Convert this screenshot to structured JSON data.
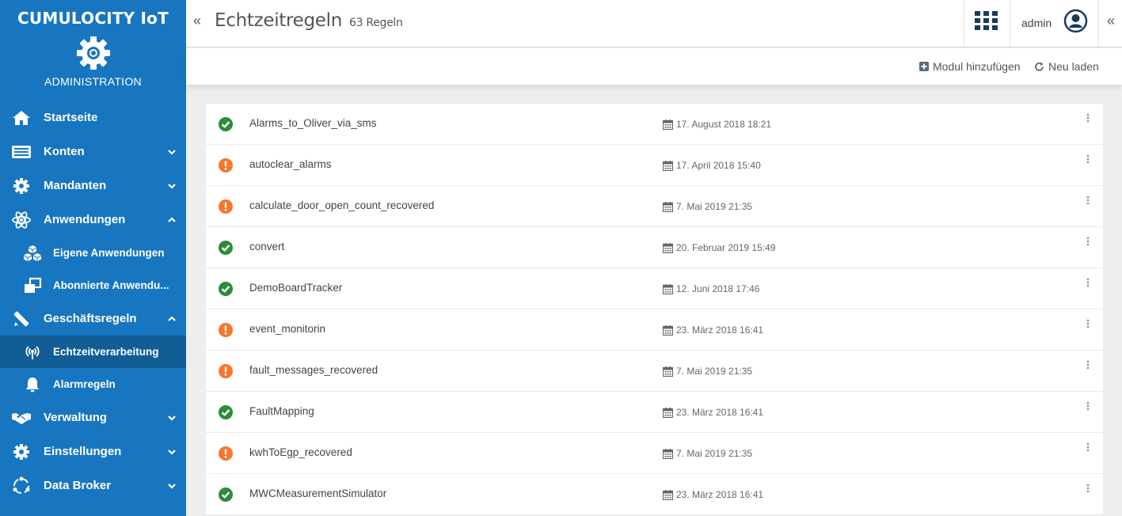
{
  "brand": {
    "title": "CUMULOCITY IoT",
    "subtitle": "ADMINISTRATION"
  },
  "sidebar": {
    "items": [
      {
        "label": "Startseite",
        "icon": "home-icon"
      },
      {
        "label": "Konten",
        "icon": "accounts-icon",
        "expanded": false
      },
      {
        "label": "Mandanten",
        "icon": "tenants-icon",
        "expanded": false
      },
      {
        "label": "Anwendungen",
        "icon": "atom-icon",
        "expanded": true
      },
      {
        "label": "Eigene Anwendungen",
        "icon": "cubes-icon"
      },
      {
        "label": "Abonnierte Anwendu...",
        "icon": "clone-icon"
      },
      {
        "label": "Geschäftsregeln",
        "icon": "pencil-ruler-icon",
        "expanded": true
      },
      {
        "label": "Echtzeitverarbeitung",
        "icon": "broadcast-icon",
        "active": true
      },
      {
        "label": "Alarmregeln",
        "icon": "bell-icon"
      },
      {
        "label": "Verwaltung",
        "icon": "handshake-icon",
        "expanded": false
      },
      {
        "label": "Einstellungen",
        "icon": "gear-icon",
        "expanded": false
      },
      {
        "label": "Data Broker",
        "icon": "sync-icon",
        "expanded": false
      }
    ]
  },
  "header": {
    "title": "Echtzeitregeln",
    "count": "63 Regeln",
    "user": "admin"
  },
  "actions": {
    "add_module": "Modul hinzufügen",
    "reload": "Neu laden"
  },
  "rules": [
    {
      "name": "Alarms_to_Oliver_via_sms",
      "date": "17. August 2018 18:21",
      "status": "ok"
    },
    {
      "name": "autoclear_alarms",
      "date": "17. April 2018 15:40",
      "status": "warning"
    },
    {
      "name": "calculate_door_open_count_recovered",
      "date": "7. Mai 2019 21:35",
      "status": "warning"
    },
    {
      "name": "convert",
      "date": "20. Februar 2019 15:49",
      "status": "ok"
    },
    {
      "name": "DemoBoardTracker",
      "date": "12. Juni 2018 17:46",
      "status": "ok"
    },
    {
      "name": "event_monitorin",
      "date": "23. März 2018 16:41",
      "status": "warning"
    },
    {
      "name": "fault_messages_recovered",
      "date": "7. Mai 2019 21:35",
      "status": "warning"
    },
    {
      "name": "FaultMapping",
      "date": "23. März 2018 16:41",
      "status": "ok"
    },
    {
      "name": "kwhToEgp_recovered",
      "date": "7. Mai 2019 21:35",
      "status": "warning"
    },
    {
      "name": "MWCMeasurementSimulator",
      "date": "23. März 2018 16:41",
      "status": "ok"
    }
  ],
  "colors": {
    "sidebar": "#1776bf",
    "sidebar_active": "#125d96",
    "ok": "#2ea043",
    "warning": "#f7772b"
  }
}
